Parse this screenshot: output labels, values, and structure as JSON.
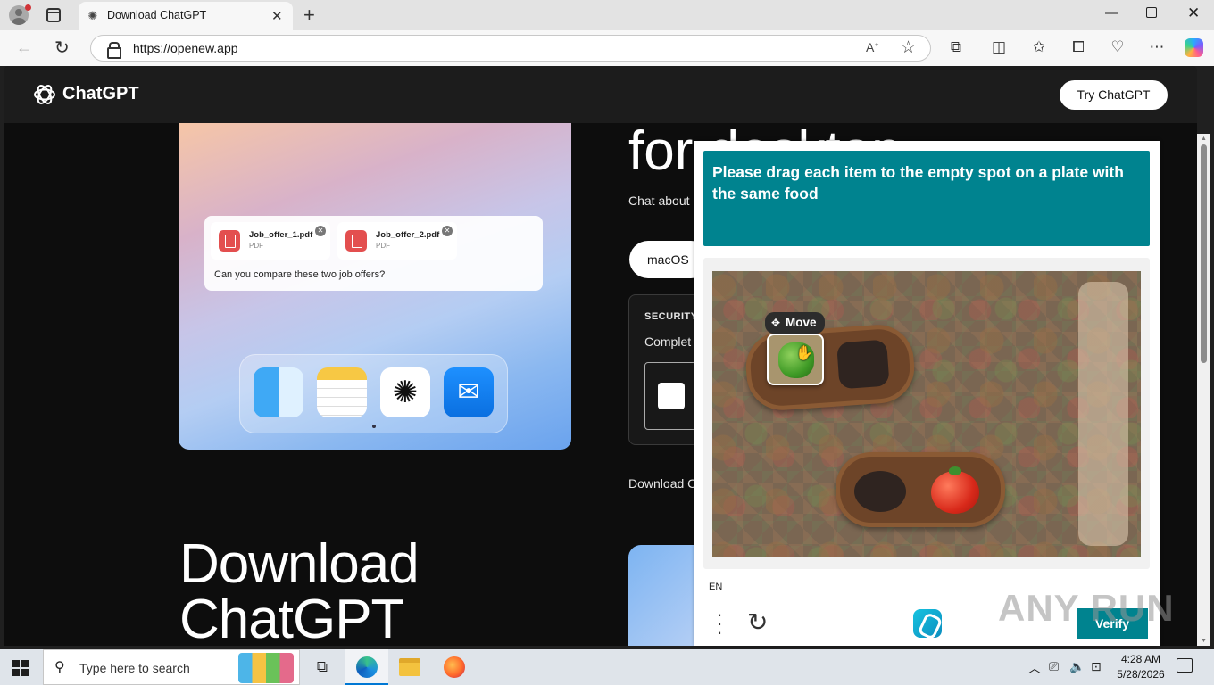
{
  "browser": {
    "tab_title": "Download ChatGPT",
    "url": "https://openew.app",
    "favicon": "chatgpt-favicon",
    "icons": [
      "profile-icon",
      "tab-actions-icon",
      "close-tab-icon",
      "new-tab-icon",
      "minimize-icon",
      "maximize-icon",
      "close-window-icon",
      "back-icon",
      "reload-icon",
      "lock-icon",
      "read-aloud-icon",
      "favorite-star-icon",
      "extensions-icon",
      "split-screen-icon",
      "favorites-icon",
      "collections-icon",
      "browser-essentials-icon",
      "more-icon",
      "copilot-icon"
    ]
  },
  "site": {
    "brand": "ChatGPT",
    "cta": "Try ChatGPT",
    "hero_heading_partial": "for desktop",
    "hero_sub_partial": "Chat about",
    "os_button": "macOS",
    "security_label": "SECURITY",
    "security_text": "Complet",
    "download_partial": "Download C",
    "big_heading": "Download ChatGPT",
    "mockup": {
      "files": [
        {
          "name": "Job_offer_1.pdf",
          "type": "PDF"
        },
        {
          "name": "Job_offer_2.pdf",
          "type": "PDF"
        }
      ],
      "question": "Can you compare these two job offers?",
      "dock_apps": [
        "finder-icon",
        "notes-icon",
        "chatgpt-icon",
        "mail-icon"
      ]
    }
  },
  "captcha": {
    "prompt": "Please drag each item to the empty spot on a plate with the same food",
    "move_label": "Move",
    "language": "EN",
    "verify_label": "Verify",
    "accent": "#00838f",
    "icons": [
      "move-icon",
      "hand-cursor-icon",
      "menu-dots-icon",
      "refresh-icon",
      "hcaptcha-logo-icon"
    ]
  },
  "watermark": "ANY RUN",
  "taskbar": {
    "search_placeholder": "Type here to search",
    "time": "4:28 AM",
    "date": "5/28/2026",
    "apps": [
      "task-view-icon",
      "edge-icon",
      "file-explorer-icon",
      "firefox-icon"
    ],
    "tray_icons": [
      "chevron-up-icon",
      "meet-now-icon",
      "volume-icon",
      "network-icon",
      "notification-icon"
    ]
  }
}
